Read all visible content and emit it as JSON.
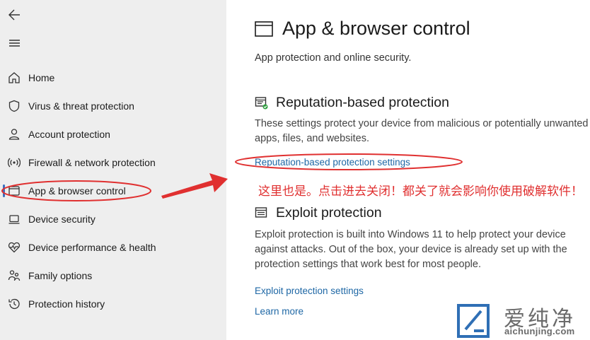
{
  "sidebar": {
    "items": [
      {
        "label": "Home",
        "icon": "home-icon"
      },
      {
        "label": "Virus & threat protection",
        "icon": "shield-icon"
      },
      {
        "label": "Account protection",
        "icon": "person-icon"
      },
      {
        "label": "Firewall & network protection",
        "icon": "wifi-icon"
      },
      {
        "label": "App & browser control",
        "icon": "window-icon",
        "active": true
      },
      {
        "label": "Device security",
        "icon": "laptop-icon"
      },
      {
        "label": "Device performance & health",
        "icon": "heart-pulse-icon"
      },
      {
        "label": "Family options",
        "icon": "family-icon"
      },
      {
        "label": "Protection history",
        "icon": "history-icon"
      }
    ]
  },
  "main": {
    "title": "App & browser control",
    "subtitle": "App protection and online security.",
    "reputation": {
      "title": "Reputation-based protection",
      "description": "These settings protect your device from malicious or potentially unwanted apps, files, and websites.",
      "link": "Reputation-based protection settings"
    },
    "exploit": {
      "title": "Exploit protection",
      "description": "Exploit protection is built into Windows 11 to help protect your device against attacks.  Out of the box, your device is already set up with the protection settings that work best for most people.",
      "link": "Exploit protection settings",
      "learn_more": "Learn more"
    }
  },
  "annotation": {
    "text": "这里也是。点击进去关闭！都关了就会影响你使用破解软件！",
    "color": "#e03030"
  },
  "watermark": {
    "text": "爱纯净",
    "url": "aichunjing.com"
  },
  "colors": {
    "accent": "#3a6fbf",
    "link": "#1e67a5",
    "sidebar_bg": "#eeeeee",
    "annotation_red": "#e03030"
  }
}
